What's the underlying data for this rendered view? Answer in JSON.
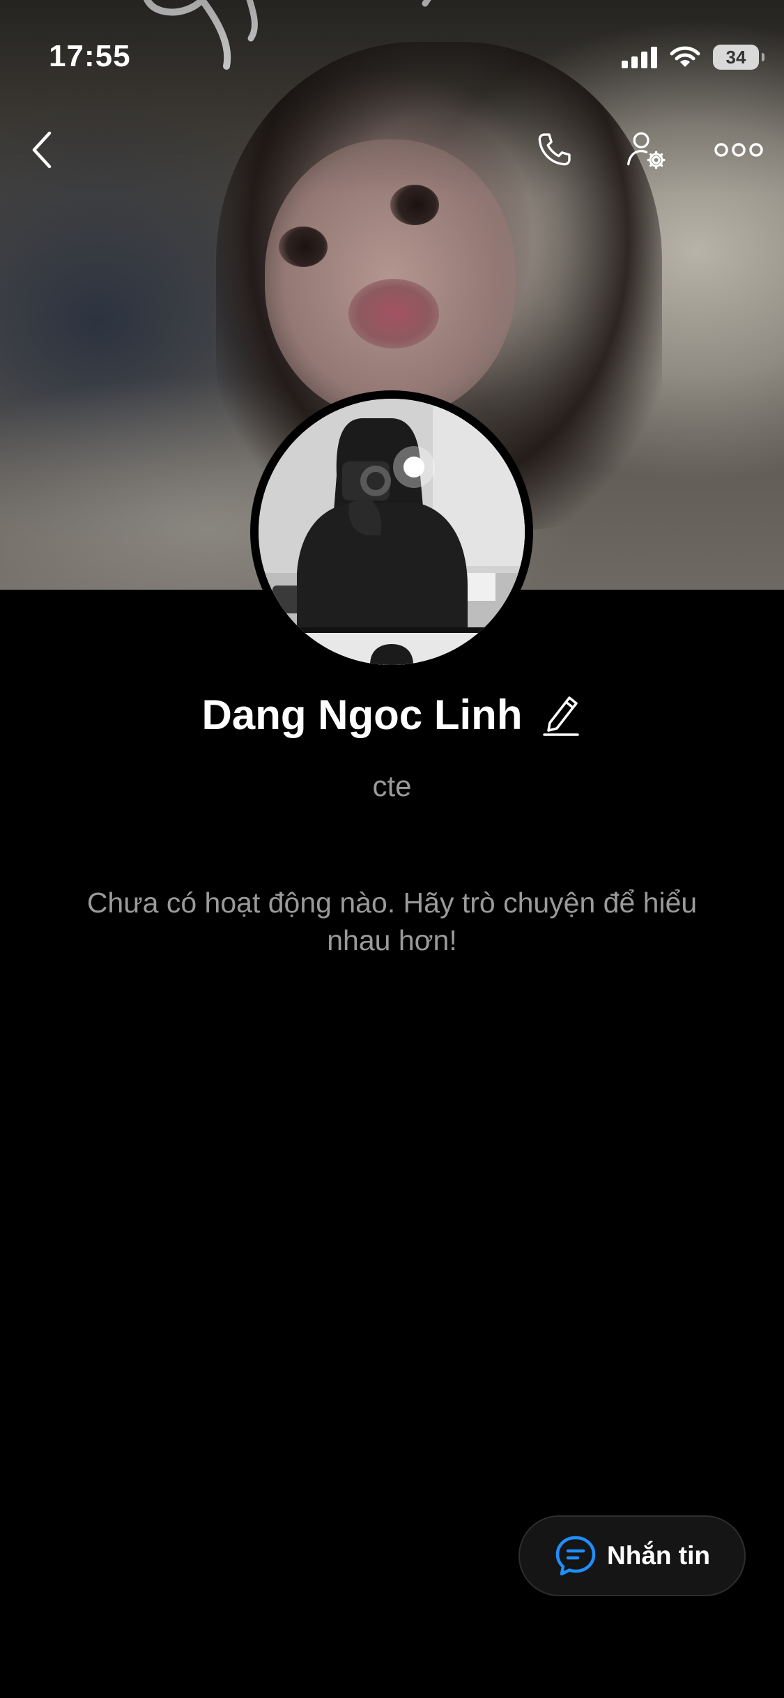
{
  "status_bar": {
    "time": "17:55",
    "battery_level": "34"
  },
  "header": {
    "back_icon": "chevron-left-icon",
    "call_icon": "phone-icon",
    "settings_icon": "user-gear-icon",
    "more_icon": "ellipsis-icon"
  },
  "profile": {
    "name": "Dang Ngoc Linh",
    "status": "cte",
    "edit_icon": "pencil-icon"
  },
  "activity": {
    "empty_message": "Chưa có hoạt động nào. Hãy trò chuyện để hiểu nhau hơn!"
  },
  "actions": {
    "message_label": "Nhắn tin",
    "message_icon": "chat-bubble-icon",
    "accent_color": "#1f8fff"
  },
  "colors": {
    "background": "#000000",
    "secondary_text": "#9a9a9a",
    "button_background": "#151515"
  }
}
